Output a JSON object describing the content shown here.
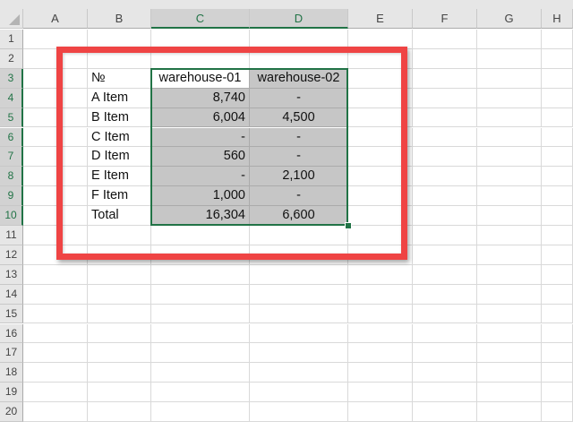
{
  "columns": [
    "A",
    "B",
    "C",
    "D",
    "E",
    "F",
    "G",
    "H"
  ],
  "rows": [
    "1",
    "2",
    "3",
    "4",
    "5",
    "6",
    "7",
    "8",
    "9",
    "10",
    "11",
    "12",
    "13",
    "14",
    "15",
    "16",
    "17",
    "18",
    "19",
    "20"
  ],
  "table": {
    "header": [
      "№",
      "warehouse-01",
      "warehouse-02"
    ],
    "rows": [
      [
        "A Item",
        "8,740",
        "-"
      ],
      [
        "B Item",
        "6,004",
        "4,500"
      ],
      [
        "C Item",
        "-",
        "-"
      ],
      [
        "D Item",
        "560",
        "-"
      ],
      [
        "E Item",
        "-",
        "2,100"
      ],
      [
        "F Item",
        "1,000",
        "-"
      ],
      [
        "Total",
        "16,304",
        "6,600"
      ]
    ]
  },
  "selection": {
    "range": "C3:D10",
    "active_cell": "C3"
  },
  "colors": {
    "selection_border": "#217346",
    "selection_fill": "#c6c6c6",
    "highlight_box": "#ef4444"
  }
}
